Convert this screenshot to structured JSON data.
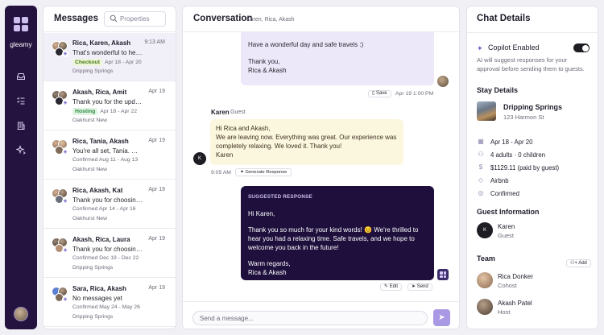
{
  "app": {
    "brand": "gleamy"
  },
  "nav": {
    "items": [
      {
        "icon": "inbox-icon"
      },
      {
        "icon": "checklist-icon"
      },
      {
        "icon": "building-icon"
      },
      {
        "icon": "sparkle-icon"
      }
    ]
  },
  "messages": {
    "title": "Messages",
    "search_placeholder": "Properties",
    "threads": [
      {
        "names": "Rica, Karen, Akash",
        "time": "9:13 AM",
        "preview": "That's wonderful to hea...",
        "badge": "Checkout",
        "badge_type": "checkout",
        "dates": "Apr 18 - Apr 20",
        "location": "Dripping Springs"
      },
      {
        "names": "Akash, Rica, Amit",
        "time": "Apr 19",
        "preview": "Thank you for the update ...",
        "badge": "Hosting",
        "badge_type": "hosting",
        "dates": "Apr 18 - Apr 22",
        "location": "Oakhurst New"
      },
      {
        "names": "Rica, Tania, Akash",
        "time": "Apr 19",
        "preview": "You're all set, Tania. We'll ...",
        "status": "Confirmed Aug 11 - Aug 13",
        "location": "Oakhurst New"
      },
      {
        "names": "Rica, Akash, Kat",
        "time": "Apr 19",
        "preview": "Thank you for choosing t...",
        "status": "Confirmed Apr 14 - Apr 16",
        "location": "Oakhurst New"
      },
      {
        "names": "Akash, Rica, Laura",
        "time": "Apr 19",
        "preview": "Thank you for choosing o...",
        "status": "Confirmed Dec 19 - Dec 22",
        "location": "Dripping Springs"
      },
      {
        "names": "Sara, Rica, Akash",
        "time": "Apr 19",
        "preview": "No messages yet",
        "status": "Confirmed May 24 - May 26",
        "location": "Dripping Springs"
      }
    ]
  },
  "conversation": {
    "title": "Conversation",
    "participants": "Karen, Rica, Akash",
    "outgoing": {
      "line1": "Have a wonderful day and safe travels :)",
      "line2": "Thank you,",
      "line3": "Rica & Akash",
      "save_label": "Save",
      "timestamp": "Apr 19 1:00 PM"
    },
    "incoming": {
      "sender": "Karen",
      "role": "Guest",
      "line1": "Hi Rica and Akash,",
      "line2": "We are leaving now. Everything was great. Our experience was completely relaxing. We loved it. Thank you!",
      "line3": "Karen",
      "avatar_initial": "K",
      "timestamp": "9:05 AM",
      "generate_label": "Generate Response"
    },
    "suggested": {
      "label": "SUGGESTED RESPONSE",
      "line1": "Hi Karen,",
      "line2": "Thank you so much for your kind words! 😊 We're thrilled to hear you had a relaxing time. Safe travels, and we hope to welcome you back in the future!",
      "line3": "Warm regards,",
      "line4": "Rica & Akash",
      "edit_label": "Edit",
      "send_label": "Send"
    },
    "composer_placeholder": "Send a message..."
  },
  "details": {
    "title": "Chat Details",
    "copilot_title": "Copilot Enabled",
    "copilot_enabled": true,
    "copilot_desc": "AI will suggest responses for your approval before sending them to guests.",
    "stay_title": "Stay Details",
    "property_name": "Dripping Springs",
    "property_address": "123 Harmon St",
    "stay_dates": "Apr 18 - Apr 20",
    "guests": "4 adults  ·  0 children",
    "payment": "$1129.11 (paid by guest)",
    "channel": "Airbnb",
    "status": "Confirmed",
    "guest_info_title": "Guest Information",
    "guest_name": "Karen",
    "guest_role": "Guest",
    "guest_initial": "K",
    "team_title": "Team",
    "add_label": "Add",
    "team": [
      {
        "name": "Rica Donker",
        "role": "Cohost"
      },
      {
        "name": "Akash Patel",
        "role": "Host"
      }
    ]
  }
}
